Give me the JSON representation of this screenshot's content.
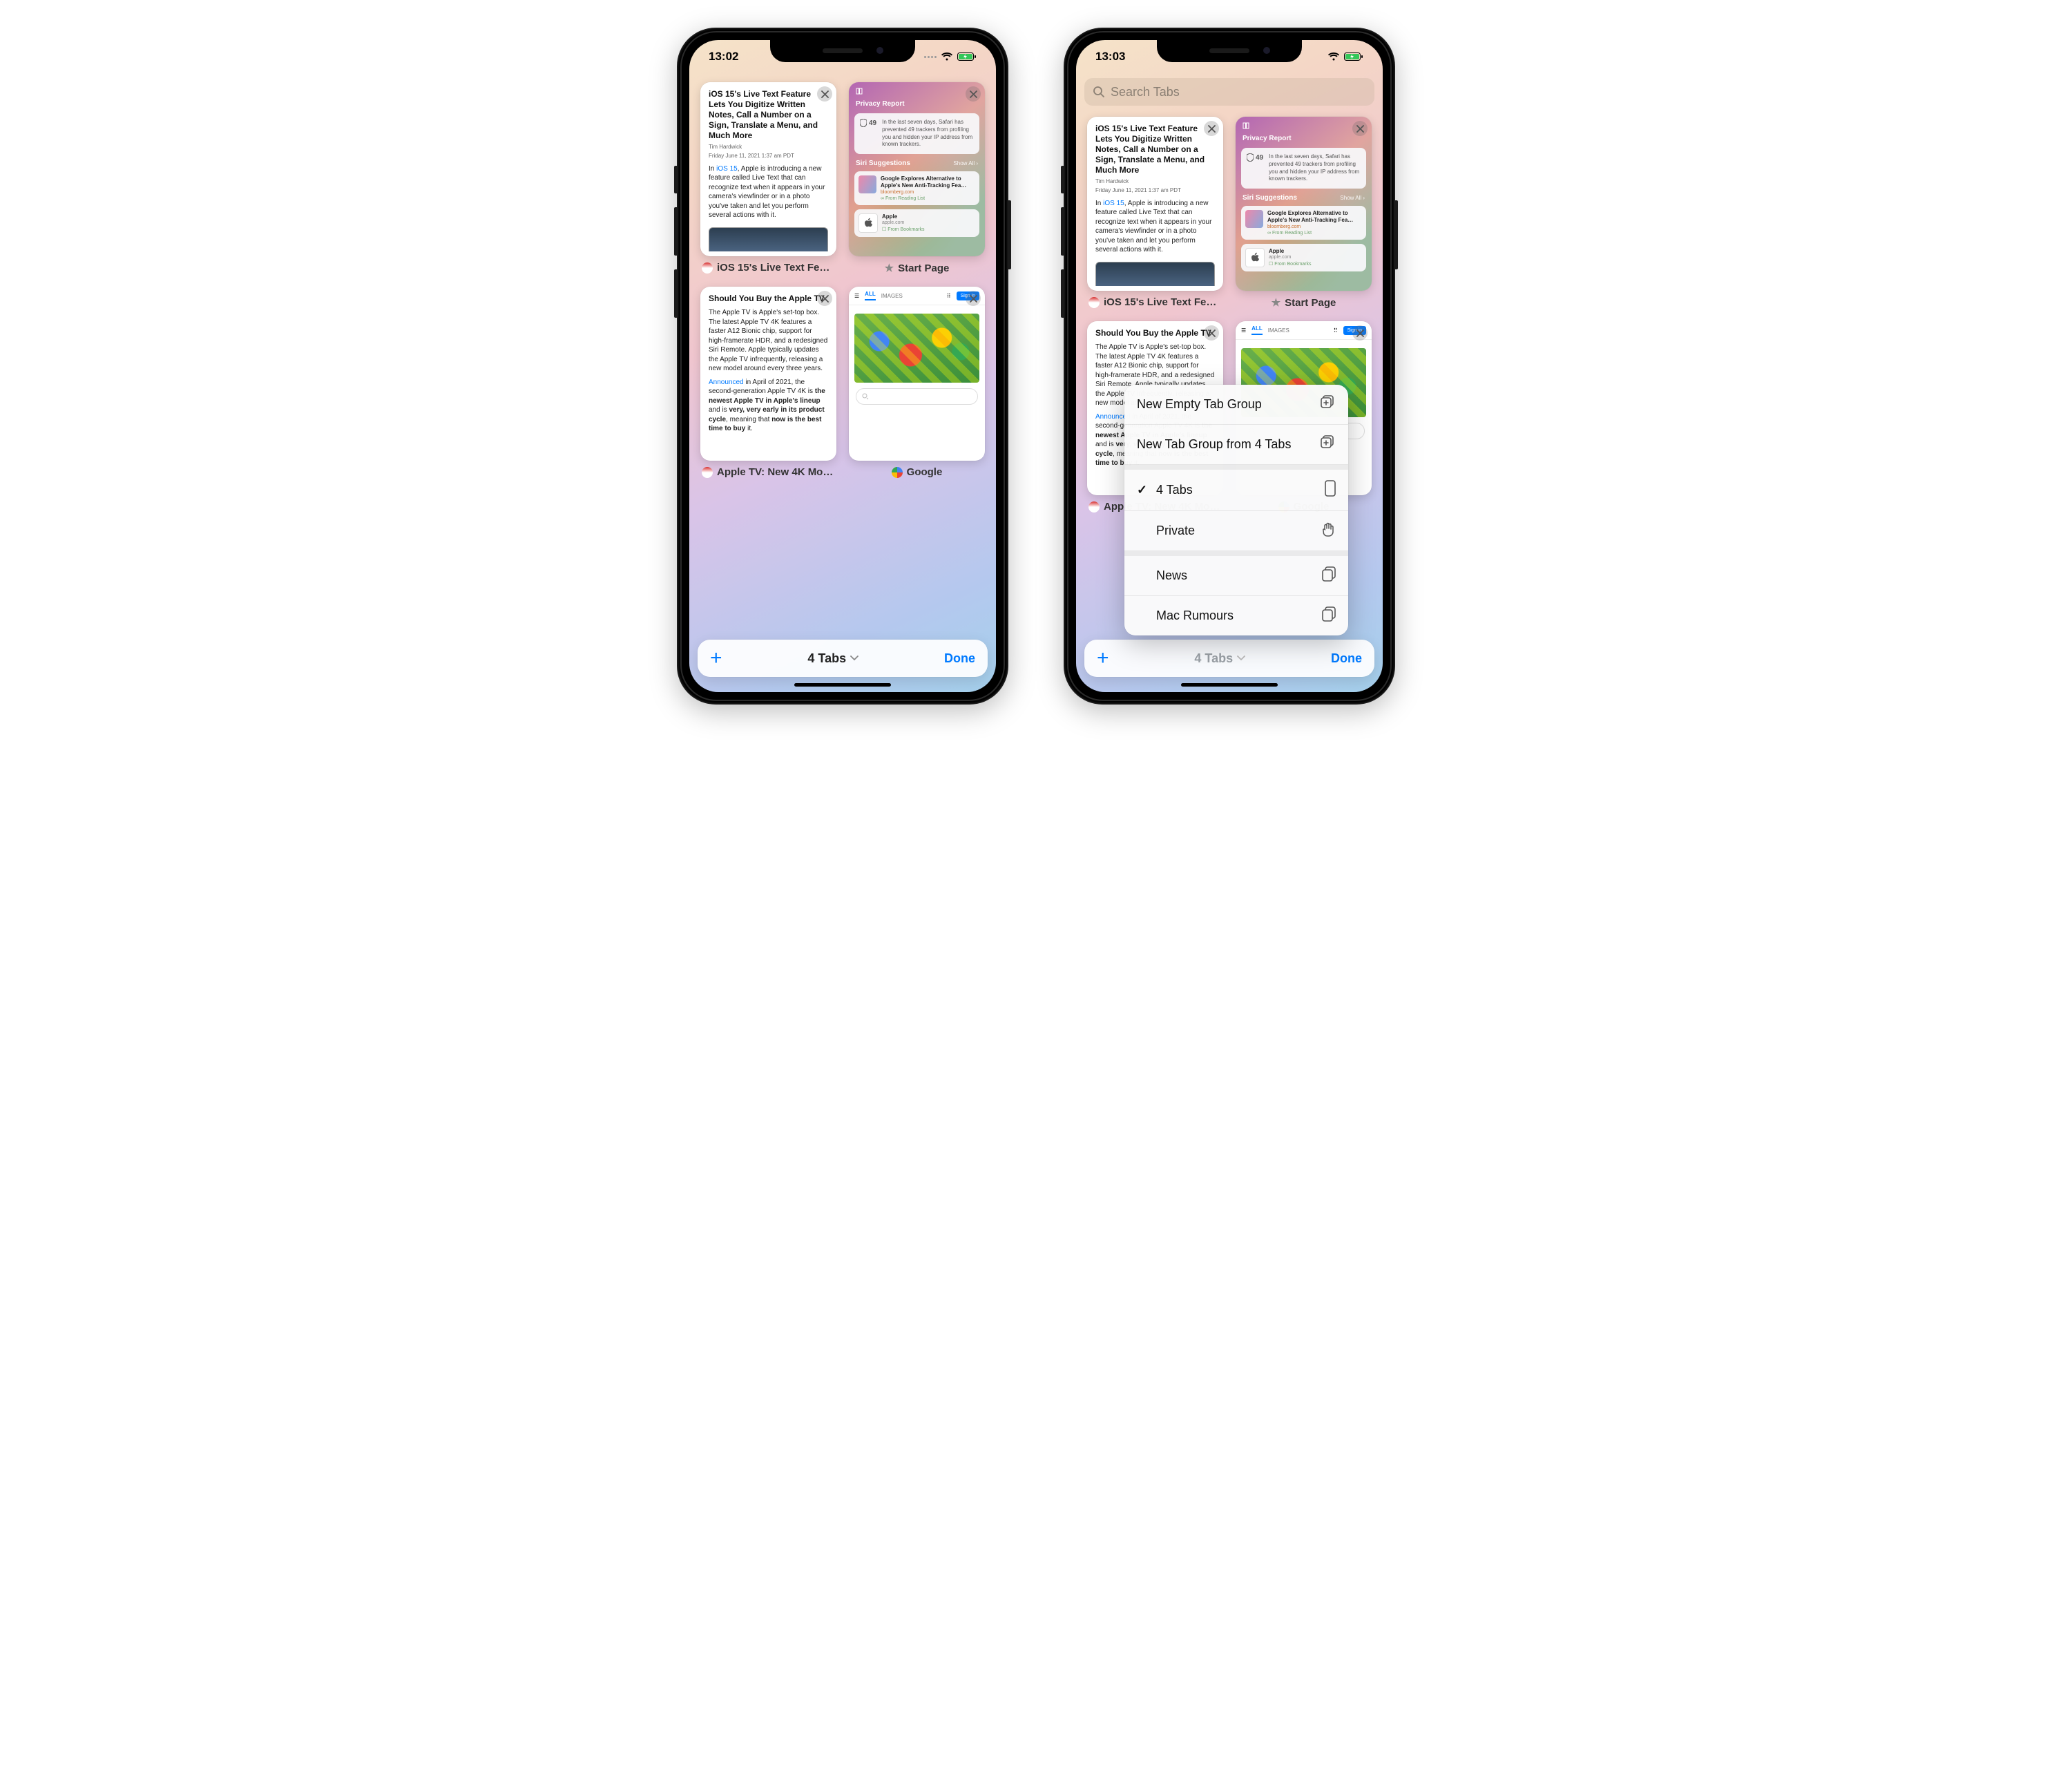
{
  "left": {
    "status": {
      "time": "13:02"
    },
    "toolbar": {
      "tabs_btn": "4 Tabs",
      "done": "Done"
    },
    "tabs": {
      "t1": {
        "label": "iOS 15's Live Text Fea…",
        "article": {
          "title": "iOS 15's Live Text Feature Lets You Digitize Written Notes, Call a Number on a Sign, Translate a Menu, and Much More",
          "author": "Tim Hardwick",
          "date": "Friday June 11, 2021 1:37 am PDT",
          "body": "In iOS 15, Apple is introducing a new feature called Live Text that can recognize text when it appears in your camera's viewfinder or in a photo you've taken and let you perform several actions with it.",
          "link": "iOS 15"
        }
      },
      "t2": {
        "label": "Start Page",
        "sp": {
          "privacy_title": "Privacy Report",
          "shield_count": "49",
          "privacy_text": "In the last seven days, Safari has prevented 49 trackers from profiling you and hidden your IP address from known trackers.",
          "siri_title": "Siri Suggestions",
          "show_all": "Show All",
          "item1_title": "Google Explores Alternative to Apple's New Anti-Tracking Fea…",
          "item1_src": "bloomberg.com",
          "item1_from": "From Reading List",
          "item2_title": "Apple",
          "item2_src": "apple.com",
          "item2_from": "From Bookmarks"
        }
      },
      "t3": {
        "label": "Apple TV: New 4K Mo…",
        "article": {
          "title": "Should You Buy the Apple TV",
          "p1": "The Apple TV is Apple's set-top box. The latest Apple TV 4K features a faster A12 Bionic chip, support for high-framerate HDR, and a redesigned Siri Remote. Apple typically updates the Apple TV infrequently, releasing a new model around every three years.",
          "p2pre": "Announced",
          "p2mid": " in April of 2021, the second-generation Apple TV 4K is ",
          "p2b1": "the newest Apple TV in Apple's lineup",
          "p2mid2": " and is ",
          "p2b2": "very, very early in its product cycle",
          "p2mid3": ", meaning that ",
          "p2b3": "now is the best time to buy",
          "p2end": " it."
        }
      },
      "t4": {
        "label": "Google",
        "g": {
          "tab_all": "ALL",
          "tab_img": "IMAGES",
          "sign": "Sign in"
        }
      }
    }
  },
  "right": {
    "status": {
      "time": "13:03"
    },
    "search": {
      "placeholder": "Search Tabs"
    },
    "toolbar": {
      "tabs_btn": "4 Tabs",
      "done": "Done"
    },
    "menu": {
      "new_empty": "New Empty Tab Group",
      "new_from": "New Tab Group from 4 Tabs",
      "four_tabs": "4 Tabs",
      "private": "Private",
      "news": "News",
      "mac_rumours": "Mac Rumours"
    },
    "tabs_ref": "left.tabs"
  }
}
